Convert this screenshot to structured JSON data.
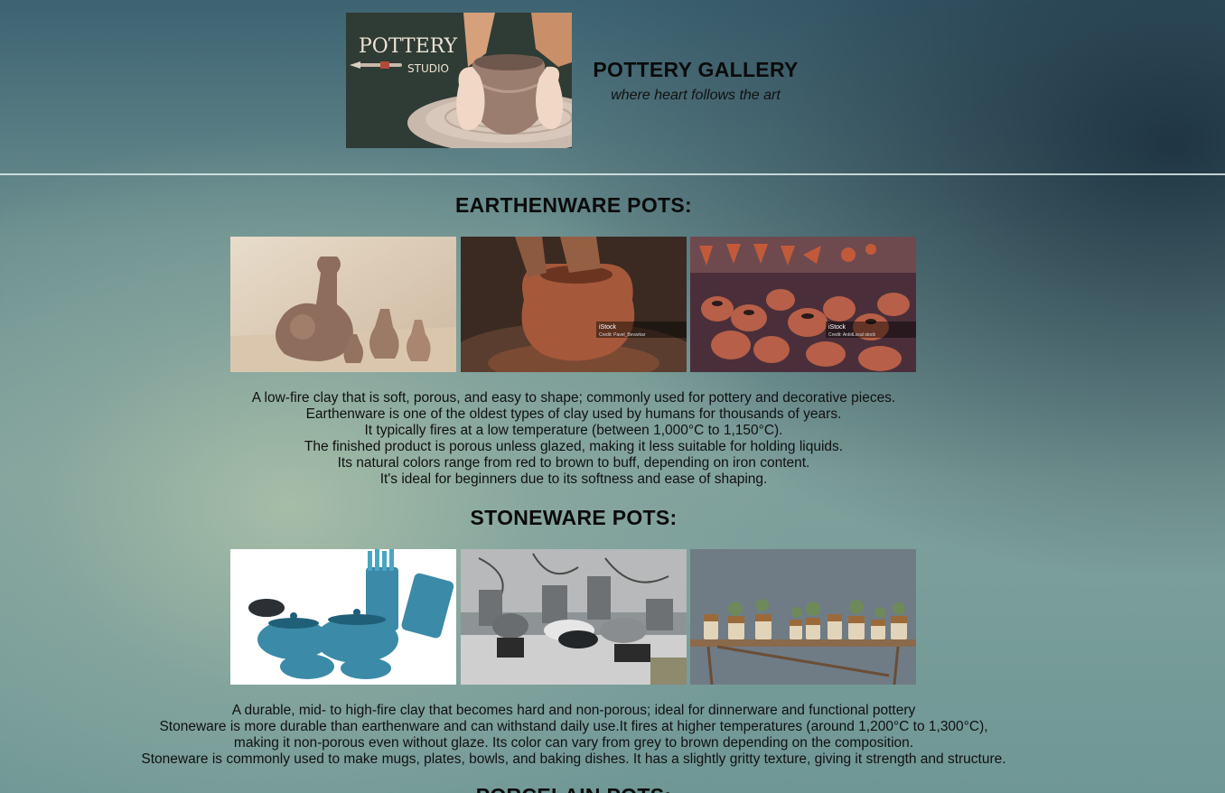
{
  "header": {
    "logo_word1": "POTTERY",
    "logo_word2": "STUDIO",
    "title": "POTTERY GALLERY",
    "tagline": "where heart follows the art"
  },
  "sections": [
    {
      "title": "EARTHENWARE POTS:",
      "images": [
        {
          "alt": "sepia earthenware vases",
          "watermark": ""
        },
        {
          "alt": "hands shaping pot on wheel",
          "watermark": "iStock",
          "credit": "Credit: Pavel_Bevarkar"
        },
        {
          "alt": "pile of clay pots",
          "watermark": "iStock",
          "credit": "Credit: AnkitLocal stock"
        }
      ],
      "paragraph": [
        "A low-fire clay that is soft, porous, and easy to shape; commonly used for pottery and decorative pieces.",
        "Earthenware is one of the oldest types of clay used by humans for thousands of years.",
        "It typically fires at a low temperature (between 1,000°C to 1,150°C).",
        "The finished product is porous unless glazed, making it less suitable for holding liquids.",
        "Its natural colors range from red to brown to buff, depending on iron content.",
        "It's ideal for beginners due to its softness and ease of shaping."
      ]
    },
    {
      "title": "STONEWARE POTS:",
      "images": [
        {
          "alt": "blue enamel cookware set"
        },
        {
          "alt": "grey stone planters"
        },
        {
          "alt": "stoneware jars on shelf"
        }
      ],
      "paragraph": [
        "A durable, mid- to high-fire clay that becomes hard and non-porous; ideal for dinnerware and functional pottery",
        "Stoneware is more durable than earthenware and can withstand daily use.It fires at higher temperatures (around 1,200°C to 1,300°C),",
        "making it non-porous even without glaze. Its color can vary from grey to brown depending on the composition.",
        "Stoneware is commonly used to make mugs, plates, bowls, and baking dishes. It has a slightly gritty texture, giving it strength and structure."
      ]
    },
    {
      "title": "PORCELAIN POTS:"
    }
  ]
}
